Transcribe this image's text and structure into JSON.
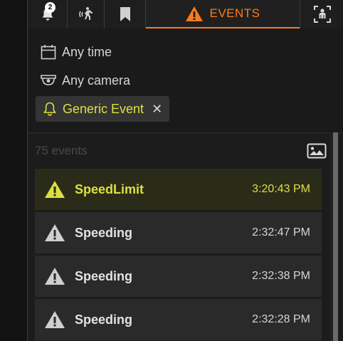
{
  "tabs": [
    {
      "name": "notifications",
      "icon": "bell-icon",
      "badge": "2"
    },
    {
      "name": "motion",
      "icon": "walking-person-icon"
    },
    {
      "name": "bookmarks",
      "icon": "bookmark-icon"
    },
    {
      "name": "events",
      "icon": "warning-icon",
      "label": "EVENTS",
      "active": true
    },
    {
      "name": "people",
      "icon": "person-frame-icon"
    }
  ],
  "filters": {
    "time": {
      "icon": "calendar-icon",
      "label": "Any time"
    },
    "camera": {
      "icon": "camera-icon",
      "label": "Any camera"
    },
    "event_type": {
      "icon": "bell-icon",
      "label": "Generic Event",
      "remove_symbol": "✕"
    }
  },
  "events_header": {
    "count_label": "75 events",
    "thumbnail_toggle_icon": "image-icon"
  },
  "events": [
    {
      "name": "SpeedLimit",
      "time": "3:20:43 PM",
      "icon": "warning-icon",
      "highlighted": true
    },
    {
      "name": "Speeding",
      "time": "2:32:47 PM",
      "icon": "warning-icon"
    },
    {
      "name": "Speeding",
      "time": "2:32:38 PM",
      "icon": "warning-icon"
    },
    {
      "name": "Speeding",
      "time": "2:32:28 PM",
      "icon": "warning-icon"
    }
  ],
  "colors": {
    "accent": "#ff7a1a",
    "highlight": "#dbe040",
    "panel": "#1c1c1c",
    "row": "#2a2a2a"
  }
}
